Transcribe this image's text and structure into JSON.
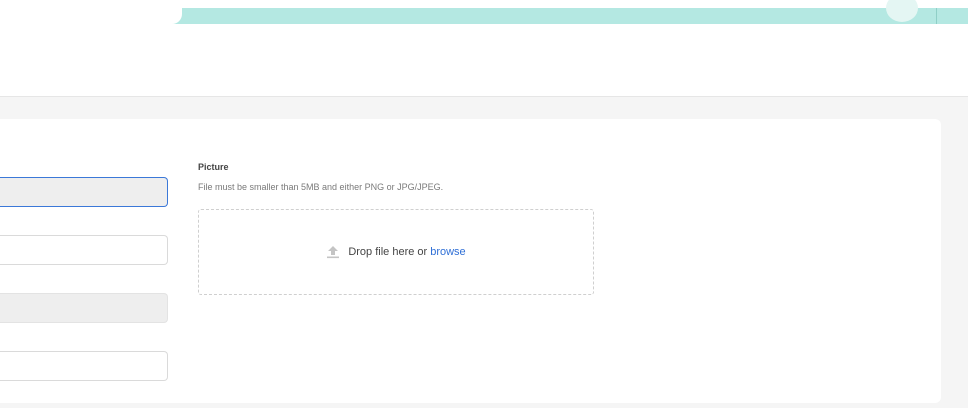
{
  "picture": {
    "label": "Picture",
    "hint": "File must be smaller than 5MB and either PNG or JPG/JPEG.",
    "drop_text": "Drop file here or",
    "browse_label": "browse"
  },
  "colors": {
    "topbar": "#b4e8e2",
    "link": "#2f6fd6",
    "focus_border": "#3b78d8"
  },
  "icons": {
    "upload": "upload-icon"
  }
}
